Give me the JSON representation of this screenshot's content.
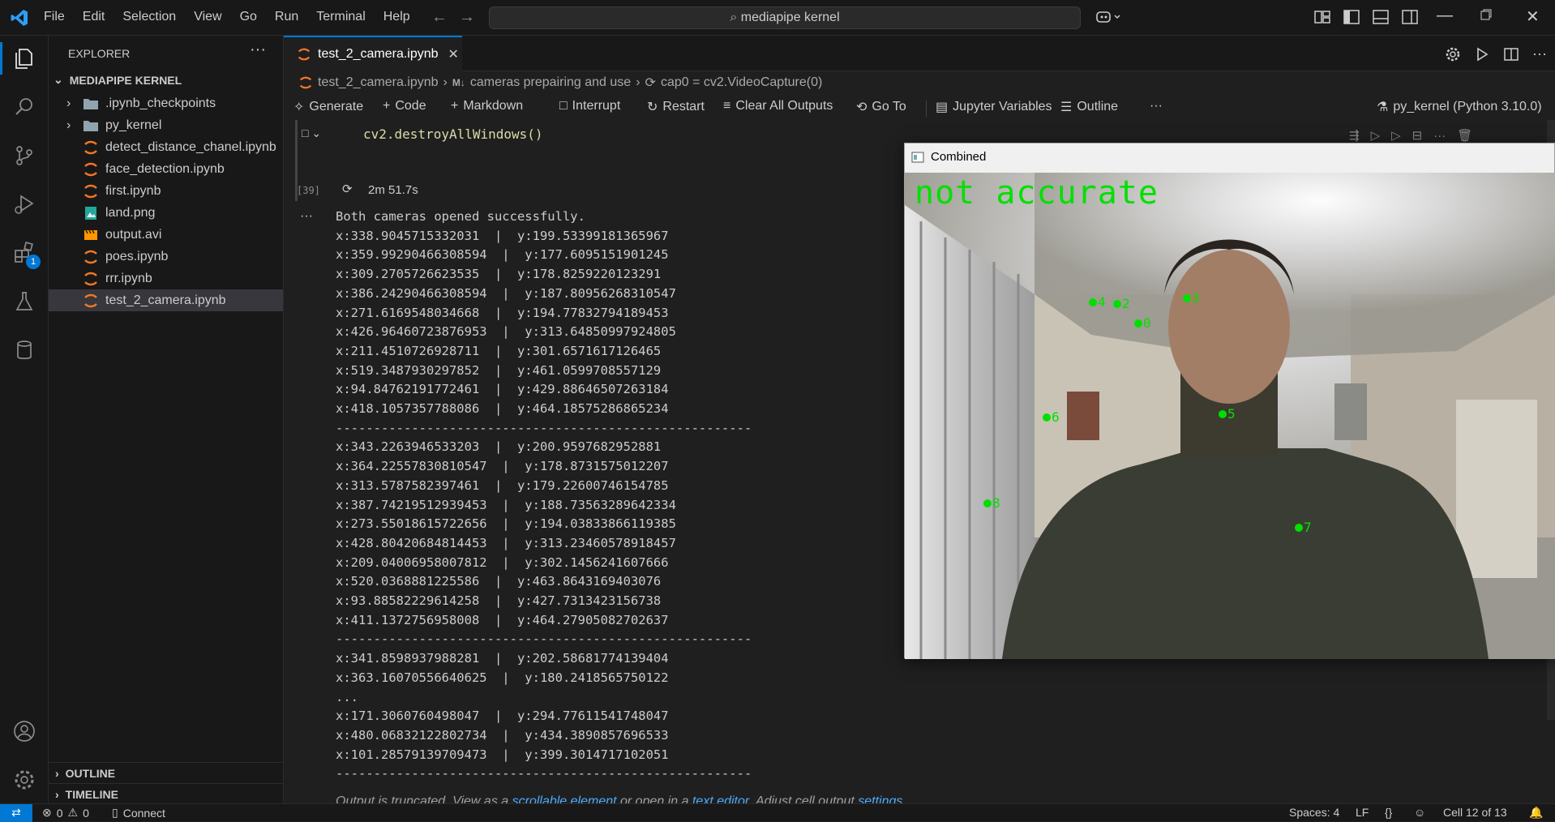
{
  "titlebar": {
    "menu": [
      "File",
      "Edit",
      "Selection",
      "View",
      "Go",
      "Run",
      "Terminal",
      "Help"
    ],
    "search_text": "mediapipe kernel"
  },
  "sidebar": {
    "title": "EXPLORER",
    "section": "MEDIAPIPE KERNEL",
    "items": [
      {
        "label": ".ipynb_checkpoints",
        "type": "folder"
      },
      {
        "label": "py_kernel",
        "type": "folder"
      },
      {
        "label": "detect_distance_chanel.ipynb",
        "type": "notebook"
      },
      {
        "label": "face_detection.ipynb",
        "type": "notebook"
      },
      {
        "label": "first.ipynb",
        "type": "notebook"
      },
      {
        "label": "land.png",
        "type": "image"
      },
      {
        "label": "output.avi",
        "type": "video"
      },
      {
        "label": "poes.ipynb",
        "type": "notebook"
      },
      {
        "label": "rrr.ipynb",
        "type": "notebook"
      },
      {
        "label": "test_2_camera.ipynb",
        "type": "notebook"
      }
    ],
    "outline_label": "OUTLINE",
    "timeline_label": "TIMELINE",
    "extensions_badge": "1"
  },
  "editor": {
    "tab_label": "test_2_camera.ipynb",
    "breadcrumbs": [
      "test_2_camera.ipynb",
      "cameras prepairing and use",
      "cap0 = cv2.VideoCapture(0)"
    ],
    "breadcrumb_md": "M↓",
    "toolbar": {
      "generate": "Generate",
      "code": "Code",
      "markdown": "Markdown",
      "interrupt": "Interrupt",
      "restart": "Restart",
      "clear": "Clear All Outputs",
      "goto": "Go To",
      "variables": "Jupyter Variables",
      "outline": "Outline",
      "more": "···",
      "kernel": "py_kernel (Python 3.10.0)"
    },
    "cell_code": "cv2.destroyAllWindows()",
    "exec_count": "[39]",
    "exec_time": "2m 51.7s",
    "output_lines": [
      "Both cameras opened successfully.",
      "x:338.9045715332031  |  y:199.53399181365967",
      "x:359.99290466308594  |  y:177.6095151901245",
      "x:309.2705726623535  |  y:178.8259220123291",
      "x:386.24290466308594  |  y:187.80956268310547",
      "x:271.6169548034668  |  y:194.77832794189453",
      "x:426.96460723876953  |  y:313.64850997924805",
      "x:211.4510726928711  |  y:301.6571617126465",
      "x:519.3487930297852  |  y:461.0599708557129",
      "x:94.84762191772461  |  y:429.88646507263184",
      "x:418.1057357788086  |  y:464.18575286865234",
      "-------------------------------------------------------",
      "x:343.2263946533203  |  y:200.9597682952881",
      "x:364.22557830810547  |  y:178.8731575012207",
      "x:313.5787582397461  |  y:179.22600746154785",
      "x:387.74219512939453  |  y:188.73563289642334",
      "x:273.55018615722656  |  y:194.03833866119385",
      "x:428.80420684814453  |  y:313.23460578918457",
      "x:209.04006958007812  |  y:302.1456241607666",
      "x:520.0368881225586  |  y:463.8643169403076",
      "x:93.88582229614258  |  y:427.7313423156738",
      "x:411.1372756958008  |  y:464.27905082702637",
      "-------------------------------------------------------",
      "x:341.8598937988281  |  y:202.58681774139404",
      "x:363.16070556640625  |  y:180.2418565750122",
      "...",
      "x:171.3060760498047  |  y:294.77611541748047",
      "x:480.06832122802734  |  y:434.3890857696533",
      "x:101.28579139709473  |  y:399.3014717102051",
      "-------------------------------------------------------"
    ],
    "truncated": {
      "prefix": "Output is truncated. View as a ",
      "link1": "scrollable element",
      "middle": " or open in a ",
      "link2": "text editor",
      "suffix": ". Adjust cell output ",
      "link3": "settings",
      "end": "..."
    }
  },
  "window": {
    "title": "Combined",
    "overlay_text": "not accurate",
    "landmarks": [
      "0",
      "2",
      "3",
      "4",
      "5",
      "6",
      "7",
      "8"
    ]
  },
  "statusbar": {
    "errors": "0",
    "warnings": "0",
    "connect": "Connect",
    "spaces": "Spaces: 4",
    "eol": "LF",
    "braces": "{}",
    "cell": "Cell 12 of 13"
  },
  "colors": {
    "accent": "#0078d4",
    "landmark": "#00e000",
    "jupyter_orange": "#f37726"
  }
}
